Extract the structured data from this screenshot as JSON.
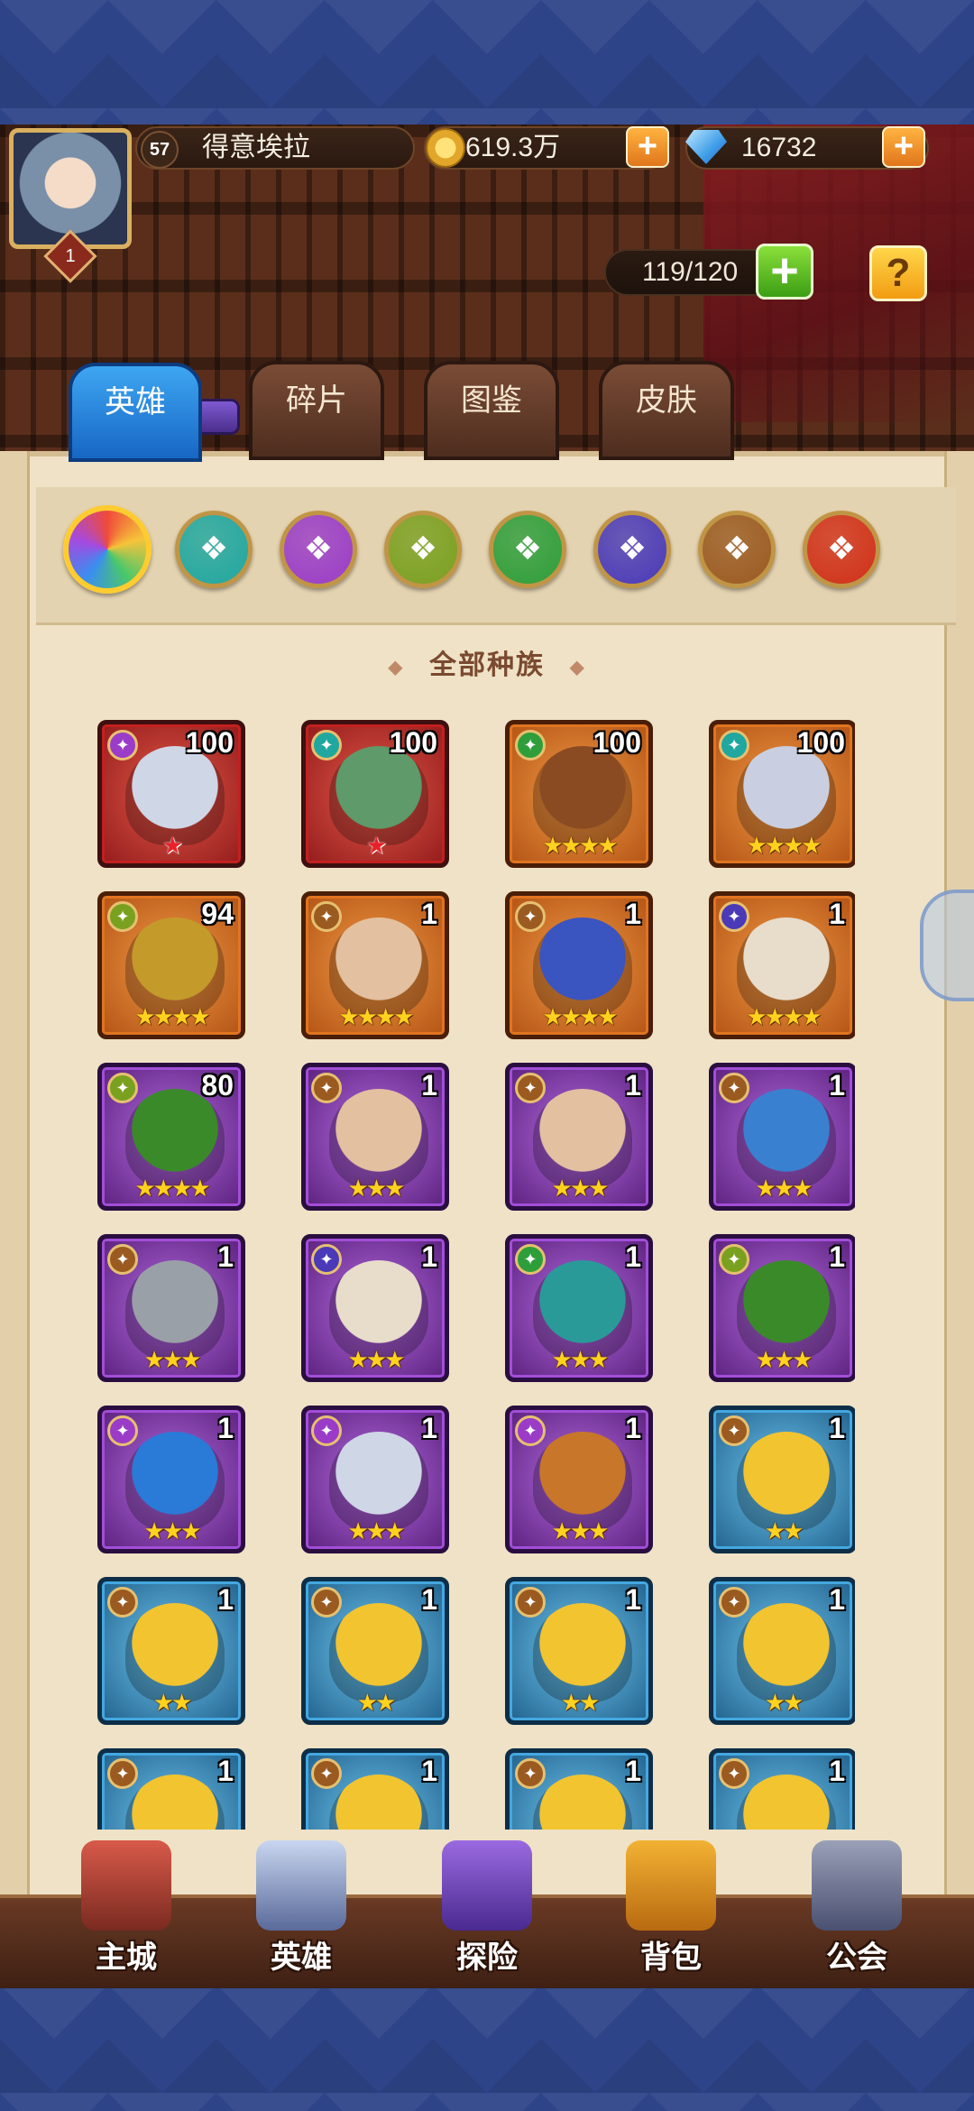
{
  "player": {
    "level": "57",
    "name": "得意埃拉",
    "avatar_level": "1"
  },
  "resources": {
    "gold": "619.3万",
    "gems": "16732",
    "hero_capacity": "119/120"
  },
  "tabs": [
    {
      "label": "英雄",
      "active": true
    },
    {
      "label": "碎片",
      "active": false
    },
    {
      "label": "图鉴",
      "active": false
    },
    {
      "label": "皮肤",
      "active": false
    }
  ],
  "race_filters": [
    {
      "icon": "all-races-icon",
      "color": "#f0a020"
    },
    {
      "icon": "race-cyan-icon",
      "color": "#1fa7a0"
    },
    {
      "icon": "race-purple-icon",
      "color": "#9a3cc8"
    },
    {
      "icon": "race-olive-icon",
      "color": "#7aa020"
    },
    {
      "icon": "race-green-icon",
      "color": "#2e9e3a"
    },
    {
      "icon": "race-indigo-icon",
      "color": "#4a3ab8"
    },
    {
      "icon": "race-brown-icon",
      "color": "#9a5a20"
    },
    {
      "icon": "race-red-icon",
      "color": "#d03018"
    }
  ],
  "filter_label": "全部种族",
  "heroes": [
    {
      "level": "100",
      "stars": "★",
      "star_color": "red",
      "quality": "red",
      "race": "purple",
      "portrait": "#cfd6e6"
    },
    {
      "level": "100",
      "stars": "★",
      "star_color": "red",
      "quality": "red",
      "race": "cyan",
      "portrait": "#5e9a6a"
    },
    {
      "level": "100",
      "stars": "★★★★",
      "star_color": "gold",
      "quality": "orange",
      "race": "green",
      "portrait": "#8a4a22"
    },
    {
      "level": "100",
      "stars": "★★★★",
      "star_color": "gold",
      "quality": "orange",
      "race": "cyan",
      "portrait": "#c9cfe0"
    },
    {
      "level": "94",
      "stars": "★★★★",
      "star_color": "gold",
      "quality": "orange",
      "race": "olive",
      "portrait": "#c49a2a"
    },
    {
      "level": "1",
      "stars": "★★★★",
      "star_color": "gold",
      "quality": "orange",
      "race": "brown",
      "portrait": "#e2c0a0"
    },
    {
      "level": "1",
      "stars": "★★★★",
      "star_color": "gold",
      "quality": "orange",
      "race": "brown",
      "portrait": "#3a54c0"
    },
    {
      "level": "1",
      "stars": "★★★★",
      "star_color": "gold",
      "quality": "orange",
      "race": "indigo",
      "portrait": "#e8dccb"
    },
    {
      "level": "80",
      "stars": "★★★★",
      "star_color": "gold",
      "quality": "purple",
      "race": "olive",
      "portrait": "#3a8a2a"
    },
    {
      "level": "1",
      "stars": "★★★",
      "star_color": "gold",
      "quality": "purple",
      "race": "brown",
      "portrait": "#e2c0a0"
    },
    {
      "level": "1",
      "stars": "★★★",
      "star_color": "gold",
      "quality": "purple",
      "race": "brown",
      "portrait": "#e2c0a0"
    },
    {
      "level": "1",
      "stars": "★★★",
      "star_color": "gold",
      "quality": "purple",
      "race": "brown",
      "portrait": "#3a80d0"
    },
    {
      "level": "1",
      "stars": "★★★",
      "star_color": "gold",
      "quality": "purple",
      "race": "brown",
      "portrait": "#9aa0a8"
    },
    {
      "level": "1",
      "stars": "★★★",
      "star_color": "gold",
      "quality": "purple",
      "race": "indigo",
      "portrait": "#e8dccb"
    },
    {
      "level": "1",
      "stars": "★★★",
      "star_color": "gold",
      "quality": "purple",
      "race": "green",
      "portrait": "#2a9a98"
    },
    {
      "level": "1",
      "stars": "★★★",
      "star_color": "gold",
      "quality": "purple",
      "race": "olive",
      "portrait": "#3a8a2a"
    },
    {
      "level": "1",
      "stars": "★★★",
      "star_color": "gold",
      "quality": "purple",
      "race": "purple",
      "portrait": "#2a7ad8"
    },
    {
      "level": "1",
      "stars": "★★★",
      "star_color": "gold",
      "quality": "purple",
      "race": "purple",
      "portrait": "#cfd6e6"
    },
    {
      "level": "1",
      "stars": "★★★",
      "star_color": "gold",
      "quality": "purple",
      "race": "purple",
      "portrait": "#c8762a"
    },
    {
      "level": "1",
      "stars": "★★",
      "star_color": "gold",
      "quality": "blue",
      "race": "brown",
      "portrait": "#f2c430"
    },
    {
      "level": "1",
      "stars": "★★",
      "star_color": "gold",
      "quality": "blue",
      "race": "brown",
      "portrait": "#f2c430"
    },
    {
      "level": "1",
      "stars": "★★",
      "star_color": "gold",
      "quality": "blue",
      "race": "brown",
      "portrait": "#f2c430"
    },
    {
      "level": "1",
      "stars": "★★",
      "star_color": "gold",
      "quality": "blue",
      "race": "brown",
      "portrait": "#f2c430"
    },
    {
      "level": "1",
      "stars": "★★",
      "star_color": "gold",
      "quality": "blue",
      "race": "brown",
      "portrait": "#f2c430"
    },
    {
      "level": "1",
      "stars": "★★",
      "star_color": "gold",
      "quality": "blue",
      "race": "brown",
      "portrait": "#f2c430"
    },
    {
      "level": "1",
      "stars": "★★",
      "star_color": "gold",
      "quality": "blue",
      "race": "brown",
      "portrait": "#f2c430"
    },
    {
      "level": "1",
      "stars": "★★",
      "star_color": "gold",
      "quality": "blue",
      "race": "brown",
      "portrait": "#f2c430"
    },
    {
      "level": "1",
      "stars": "★★",
      "star_color": "gold",
      "quality": "blue",
      "race": "brown",
      "portrait": "#f2c430"
    }
  ],
  "bottom_nav": [
    {
      "label": "主城",
      "icon": "castle-icon"
    },
    {
      "label": "英雄",
      "icon": "hero-portrait-icon"
    },
    {
      "label": "探险",
      "icon": "portal-icon"
    },
    {
      "label": "背包",
      "icon": "backpack-icon"
    },
    {
      "label": "公会",
      "icon": "guild-tower-icon"
    }
  ]
}
